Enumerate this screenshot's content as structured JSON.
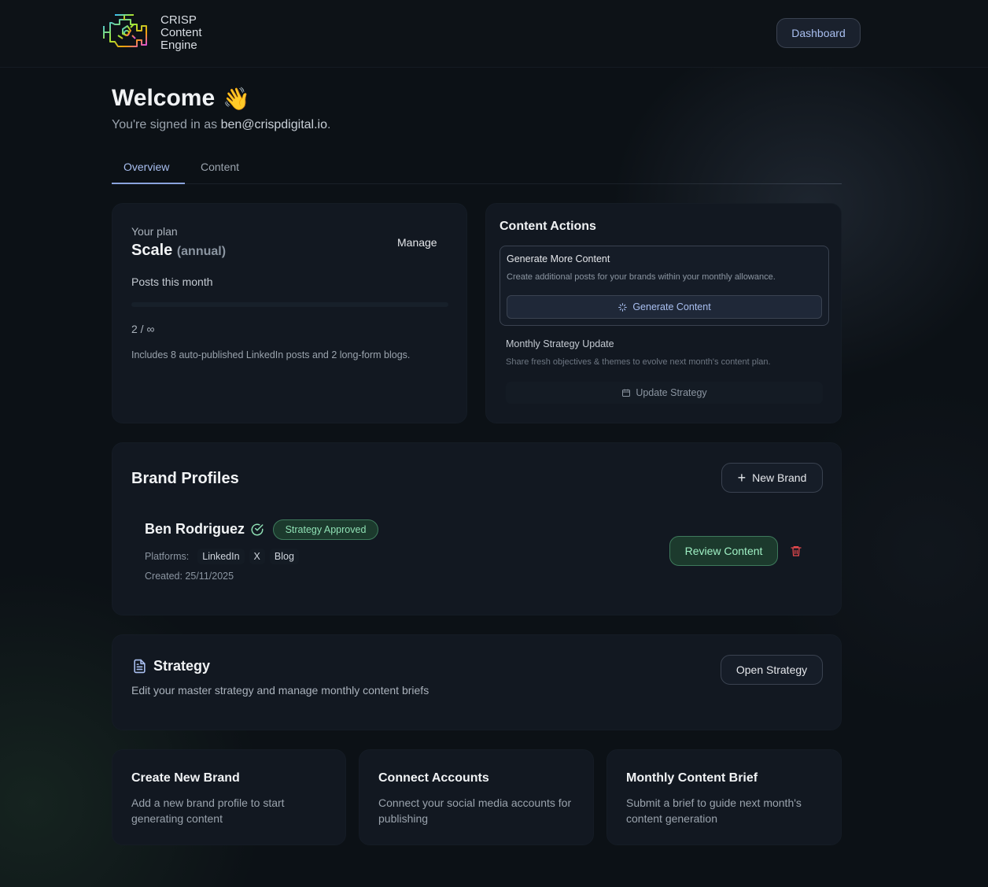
{
  "brand": {
    "logo_line1": "CRISP",
    "logo_line2": "Content",
    "logo_line3": "Engine"
  },
  "header": {
    "dashboard_label": "Dashboard"
  },
  "welcome": {
    "title": "Welcome",
    "emoji": "👋",
    "signed_in_prefix": "You're signed in as ",
    "email": "ben@crispdigital.io",
    "signed_in_suffix": "."
  },
  "tabs": [
    {
      "label": "Overview",
      "active": true
    },
    {
      "label": "Content",
      "active": false
    }
  ],
  "plan": {
    "label": "Your plan",
    "name": "Scale",
    "cycle": "(annual)",
    "manage_label": "Manage",
    "posts_label": "Posts this month",
    "usage_text": "2 / ∞",
    "usage_fraction": 0,
    "includes_text": "Includes 8 auto-published LinkedIn posts and 2 long-form blogs."
  },
  "content_actions": {
    "title": "Content Actions",
    "generate": {
      "heading": "Generate More Content",
      "description": "Create additional posts for your brands within your monthly allowance.",
      "button_label": "Generate Content",
      "icon": "sparkles-icon"
    },
    "strategy_update": {
      "heading": "Monthly Strategy Update",
      "description": "Share fresh objectives & themes to evolve next month's content plan.",
      "button_label": "Update Strategy",
      "icon": "calendar-icon"
    }
  },
  "brand_profiles": {
    "title": "Brand Profiles",
    "new_brand_label": "New Brand",
    "items": [
      {
        "name": "Ben Rodriguez",
        "status": "Strategy Approved",
        "platforms_label": "Platforms:",
        "platforms": [
          "LinkedIn",
          "X",
          "Blog"
        ],
        "created": "Created: 25/11/2025",
        "review_label": "Review Content"
      }
    ]
  },
  "strategy": {
    "title": "Strategy",
    "description": "Edit your master strategy and manage monthly content briefs",
    "open_label": "Open Strategy"
  },
  "quick_links": [
    {
      "title": "Create New Brand",
      "description": "Add a new brand profile to start generating content"
    },
    {
      "title": "Connect Accounts",
      "description": "Connect your social media accounts for publishing"
    },
    {
      "title": "Monthly Content Brief",
      "description": "Submit a brief to guide next month's content generation"
    }
  ],
  "colors": {
    "background": "#0c1116",
    "card": "#121821",
    "accent_blue": "#a9bff0",
    "accent_green": "#8fe0b4",
    "danger": "#e5484d"
  }
}
